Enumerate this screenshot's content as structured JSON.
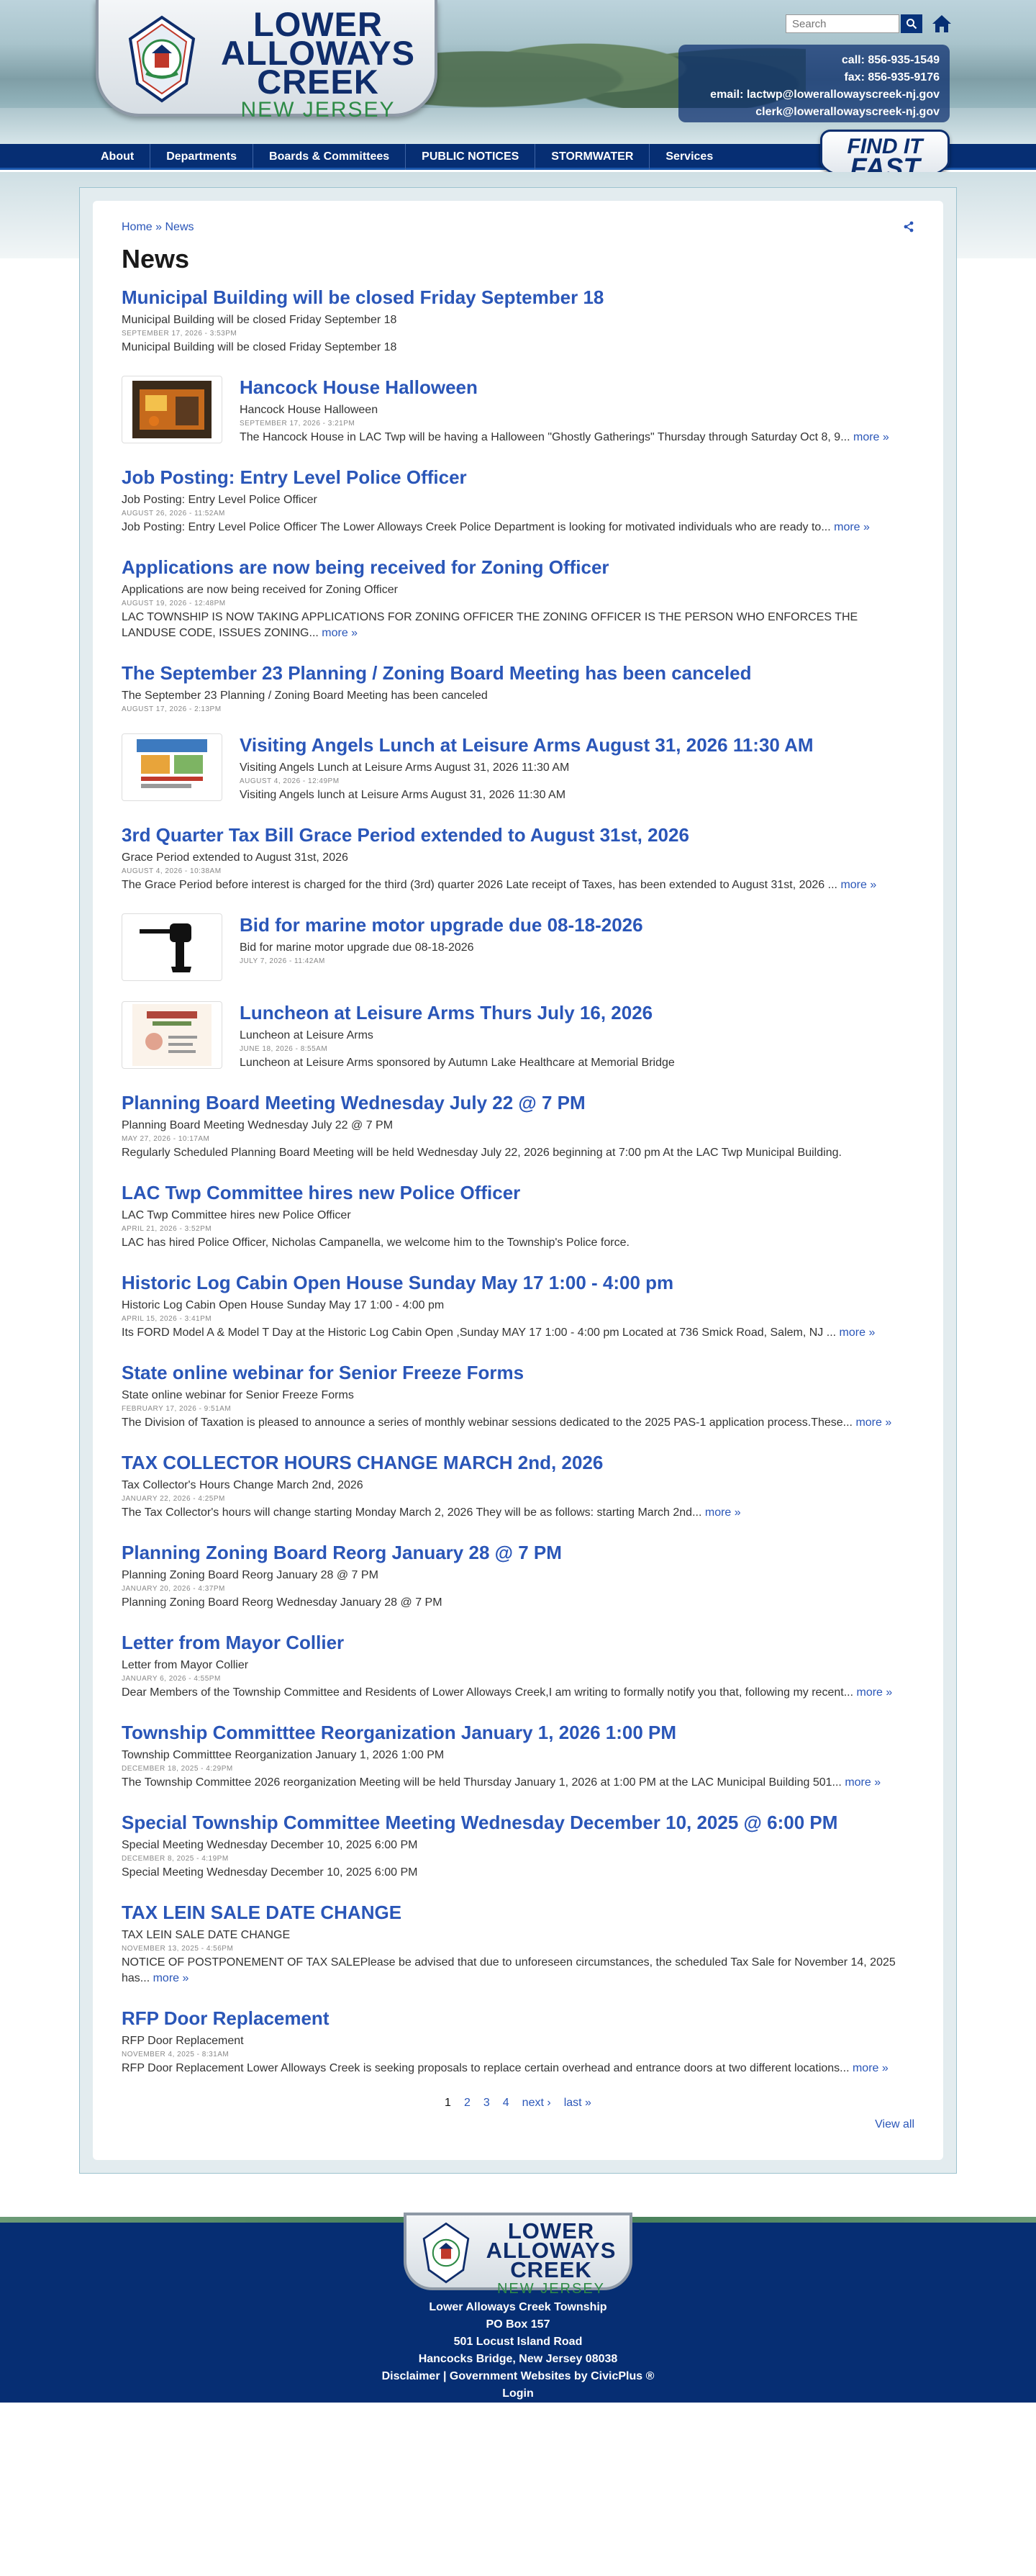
{
  "site": {
    "logo_line1": "LOWER",
    "logo_line2": "ALLOWAYS",
    "logo_line3": "CREEK",
    "logo_sub": "NEW JERSEY"
  },
  "search": {
    "placeholder": "Search"
  },
  "contact": {
    "call": "call: 856-935-1549",
    "fax": "fax: 856-935-9176",
    "email1": "email: lactwp@lowerallowayscreek-nj.gov",
    "email2": "clerk@lowerallowayscreek-nj.gov"
  },
  "nav": [
    "About",
    "Departments",
    "Boards & Committees",
    "PUBLIC NOTICES",
    "STORMWATER",
    "Services"
  ],
  "findit": {
    "line1": "FIND IT",
    "line2": "FAST"
  },
  "breadcrumb": {
    "home": "Home",
    "sep": " » ",
    "current": "News"
  },
  "page_title": "News",
  "more_label": "more »",
  "items": [
    {
      "title": "Municipal Building will be closed Friday September 18",
      "summary": "Municipal Building will be closed Friday September 18",
      "date": "SEPTEMBER 17, 2026 - 3:53PM",
      "body": "Municipal Building will be closed Friday September 18",
      "more": false,
      "thumb": null
    },
    {
      "title": "Hancock House Halloween",
      "summary": "Hancock House Halloween",
      "date": "SEPTEMBER 17, 2026 - 3:21PM",
      "body": "The Hancock House in LAC Twp will be having a Halloween \"Ghostly Gatherings\" Thursday through Saturday Oct 8, 9...",
      "more": true,
      "thumb": "halloween"
    },
    {
      "title": "Job Posting: Entry Level Police Officer",
      "summary": "Job Posting: Entry Level Police Officer",
      "date": "AUGUST 26, 2026 - 11:52AM",
      "body": "Job Posting: Entry Level Police Officer  The Lower Alloways Creek Police Department is looking for motivated individuals who are ready to...",
      "more": true,
      "thumb": null
    },
    {
      "title": "Applications are now being received for Zoning Officer",
      "summary": "Applications are now being received for Zoning Officer",
      "date": "AUGUST 19, 2026 - 12:48PM",
      "body": "LAC TOWNSHIP IS NOW TAKING APPLICATIONS FOR ZONING OFFICER  THE ZONING OFFICER IS THE PERSON WHO ENFORCES THE LANDUSE CODE, ISSUES ZONING...",
      "more": true,
      "thumb": null
    },
    {
      "title": "The September 23 Planning / Zoning Board Meeting has been canceled",
      "summary": "The September 23 Planning / Zoning Board Meeting has been canceled",
      "date": "AUGUST 17, 2026 - 2:13PM",
      "body": "",
      "more": false,
      "thumb": null
    },
    {
      "title": "Visiting Angels Lunch at Leisure Arms August 31, 2026 11:30 AM",
      "summary": "Visiting Angels Lunch at Leisure Arms August 31, 2026 11:30 AM",
      "date": "AUGUST 4, 2026 - 12:49PM",
      "body": "Visiting Angels lunch at Leisure Arms August 31, 2026 11:30 AM",
      "more": false,
      "thumb": "flyer"
    },
    {
      "title": "3rd Quarter Tax Bill Grace Period extended to August 31st, 2026",
      "summary": "Grace Period extended to August 31st, 2026",
      "date": "AUGUST 4, 2026 - 10:38AM",
      "body": "The Grace Period before interest is charged for the third (3rd) quarter 2026 Late receipt of Taxes, has been extended to August 31st, 2026 ...",
      "more": true,
      "thumb": null
    },
    {
      "title": "Bid for marine motor upgrade due 08-18-2026",
      "summary": "Bid for marine motor upgrade due 08-18-2026",
      "date": "JULY 7, 2026 - 11:42AM",
      "body": "",
      "more": false,
      "thumb": "motor"
    },
    {
      "title": "Luncheon at Leisure Arms Thurs July 16, 2026",
      "summary": "Luncheon at Leisure Arms",
      "date": "JUNE 18, 2026 - 8:55AM",
      "body": "Luncheon at Leisure Arms sponsored by Autumn Lake Healthcare at Memorial Bridge",
      "more": false,
      "thumb": "luncheon"
    },
    {
      "title": "Planning Board Meeting Wednesday July 22 @ 7 PM",
      "summary": "Planning Board Meeting Wednesday July 22 @ 7 PM",
      "date": "MAY 27, 2026 - 10:17AM",
      "body": "Regularly Scheduled Planning Board Meeting will be held Wednesday July 22, 2026 beginning at 7:00 pm  At the LAC Twp Municipal Building.",
      "more": false,
      "thumb": null
    },
    {
      "title": "LAC Twp Committee hires new Police Officer",
      "summary": "LAC Twp Committee hires new Police Officer",
      "date": "APRIL 21, 2026 - 3:52PM",
      "body": "LAC has hired Police Officer, Nicholas Campanella, we welcome him to the Township's Police force.",
      "more": false,
      "thumb": null
    },
    {
      "title": "Historic Log Cabin Open House Sunday May 17 1:00 - 4:00 pm",
      "summary": "Historic Log Cabin Open House Sunday May 17 1:00 - 4:00 pm",
      "date": "APRIL 15, 2026 - 3:41PM",
      "body": " Its FORD Model A & Model T Day at the Historic Log Cabin Open ,Sunday MAY 17 1:00 - 4:00 pm  Located at 736 Smick Road, Salem, NJ ...",
      "more": true,
      "thumb": null
    },
    {
      "title": "State online webinar for Senior Freeze Forms",
      "summary": "State online webinar for Senior Freeze Forms",
      "date": "FEBRUARY 17, 2026 - 9:51AM",
      "body": "The Division of Taxation is pleased to announce a series of monthly webinar sessions dedicated to the 2025 PAS-1 application process.These...",
      "more": true,
      "thumb": null
    },
    {
      "title": "TAX COLLECTOR HOURS CHANGE MARCH 2nd, 2026",
      "summary": "Tax Collector's Hours Change March 2nd, 2026",
      "date": "JANUARY 22, 2026 - 4:25PM",
      "body": "The Tax Collector's hours will change starting Monday March 2, 2026  They will be as follows: starting March 2nd...",
      "more": true,
      "thumb": null
    },
    {
      "title": "Planning Zoning Board Reorg January 28 @ 7 PM",
      "summary": "Planning Zoning Board Reorg January 28 @ 7 PM",
      "date": "JANUARY 20, 2026 - 4:37PM",
      "body": " Planning Zoning Board Reorg Wednesday January 28 @ 7 PM",
      "more": false,
      "thumb": null
    },
    {
      "title": "Letter from Mayor Collier",
      "summary": "Letter from Mayor Collier",
      "date": "JANUARY 6, 2026 - 4:55PM",
      "body": "Dear Members of the Township Committee and Residents of Lower Alloways Creek,I am writing to formally notify you that, following my recent...",
      "more": true,
      "thumb": null
    },
    {
      "title": "Township Committtee Reorganization January 1, 2026 1:00 PM",
      "summary": "Township Committtee Reorganization January 1, 2026 1:00 PM",
      "date": "DECEMBER 18, 2025 - 4:29PM",
      "body": "The Township Committee 2026 reorganization Meeting will be held Thursday January 1, 2026 at 1:00 PM at the LAC Municipal Building 501...",
      "more": true,
      "thumb": null
    },
    {
      "title": "Special Township Committee Meeting Wednesday December 10, 2025 @ 6:00 PM",
      "summary": "Special Meeting Wednesday December 10, 2025 6:00 PM",
      "date": "DECEMBER 8, 2025 - 4:19PM",
      "body": "Special Meeting Wednesday December 10, 2025  6:00 PM",
      "more": false,
      "thumb": null
    },
    {
      "title": "TAX LEIN SALE DATE CHANGE",
      "summary": "TAX LEIN SALE DATE CHANGE",
      "date": "NOVEMBER 13, 2025 - 4:56PM",
      "body": "NOTICE OF POSTPONEMENT OF TAX SALEPlease be advised that due to unforeseen circumstances, the scheduled Tax Sale for November 14, 2025 has...",
      "more": true,
      "thumb": null
    },
    {
      "title": "RFP Door Replacement",
      "summary": "RFP Door Replacement",
      "date": "NOVEMBER 4, 2025 - 8:31AM",
      "body": "RFP Door Replacement  Lower Alloways Creek is seeking proposals to replace certain overhead and entrance doors at two different locations...",
      "more": true,
      "thumb": null
    }
  ],
  "pager": {
    "pages": [
      "1",
      "2",
      "3",
      "4"
    ],
    "next": "next ›",
    "last": "last »"
  },
  "view_all": "View all",
  "footer": {
    "line1": "Lower Alloways Creek Township",
    "line2": "PO Box 157",
    "line3": "501 Locust Island Road",
    "line4": "Hancocks Bridge, New Jersey 08038",
    "disclaimer": "Disclaimer",
    "gov_sites": "Government Websites by CivicPlus ®",
    "login": "Login"
  },
  "icons": [
    "search-icon",
    "home-icon",
    "share-icon"
  ],
  "colors": {
    "navy": "#062e73",
    "link": "#2a56b8",
    "green": "#2e8a46"
  }
}
